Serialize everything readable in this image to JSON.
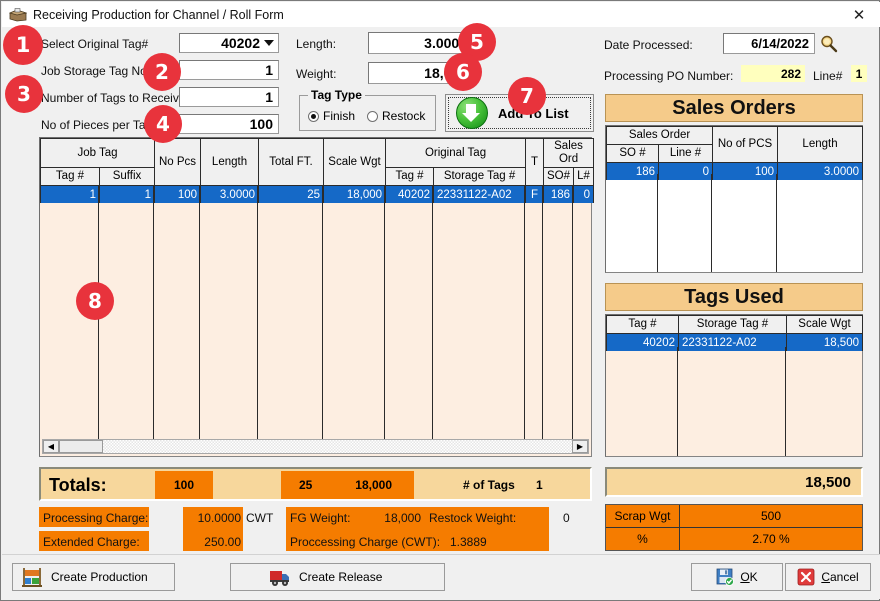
{
  "window": {
    "title": "Receiving Production for Channel / Roll Form",
    "close_label": "✕",
    "icon": "box-icon"
  },
  "form": {
    "select_original_tag_label": "Select Original Tag#",
    "select_original_tag_value": "40202",
    "job_storage_tag_label": "Job Storage Tag No:",
    "job_storage_tag_value": "1",
    "number_of_tags_label": "Number of Tags to Receive:",
    "number_of_tags_value": "1",
    "pieces_per_tag_label": "No of Pieces per Tag:",
    "pieces_per_tag_value": "100",
    "length_label": "Length:",
    "length_value": "3.0000",
    "weight_label": "Weight:",
    "weight_value": "18,000",
    "tag_type_title": "Tag Type",
    "tag_type_finish": "Finish",
    "tag_type_restock": "Restock",
    "tag_type_selected": "Finish",
    "add_to_list_label": "Add To List"
  },
  "header_right": {
    "date_processed_label": "Date Processed:",
    "date_processed_value": "6/14/2022",
    "date_picker_icon": "magnifier-icon",
    "po_number_label": "Processing PO Number:",
    "po_number_value": "282",
    "line_label": "Line#",
    "line_value": "1"
  },
  "main_grid": {
    "group_headers": {
      "job_tag": "Job Tag",
      "original_tag": "Original Tag",
      "sales_ord": "Sales Ord"
    },
    "columns": [
      "Tag #",
      "Suffix",
      "No Pcs",
      "Length",
      "Total FT.",
      "Scale Wgt",
      "Tag #",
      "Storage Tag #",
      "T",
      "SO#",
      "L#"
    ],
    "rows": [
      {
        "tag_no": "1",
        "suffix": "1",
        "no_pcs": "100",
        "length": "3.0000",
        "total_ft": "25",
        "scale_wgt": "18,000",
        "orig_tag_no": "40202",
        "orig_storage_tag": "22331122-A02",
        "t": "F",
        "so": "186",
        "l": "0"
      }
    ]
  },
  "sales_orders": {
    "panel_title": "Sales Orders",
    "group_header": "Sales Order",
    "columns": [
      "SO #",
      "Line #",
      "No of PCS",
      "Length"
    ],
    "rows": [
      {
        "so": "186",
        "line": "0",
        "no_of_pcs": "100",
        "length": "3.0000"
      }
    ]
  },
  "tags_used": {
    "panel_title": "Tags Used",
    "columns": [
      "Tag #",
      "Storage Tag #",
      "Scale Wgt"
    ],
    "rows": [
      {
        "tag": "40202",
        "storage_tag": "22331122-A02",
        "scale_wgt": "18,500"
      }
    ],
    "total": "18,500",
    "scrap_wgt_label": "Scrap Wgt",
    "scrap_wgt_value": "500",
    "percent_label": "%",
    "percent_value": "2.70 %"
  },
  "totals": {
    "label": "Totals:",
    "no_pcs": "100",
    "total_ft": "25",
    "scale_wgt": "18,000",
    "num_tags_label": "# of Tags",
    "num_tags_value": "1",
    "processing_charge_label": "Processing Charge:",
    "processing_charge_value": "10.0000",
    "processing_charge_unit": "CWT",
    "extended_charge_label": "Extended Charge:",
    "extended_charge_value": "250.00",
    "fg_weight_label": "FG Weight:",
    "fg_weight_value": "18,000",
    "restock_weight_label": "Restock Weight:",
    "restock_weight_value": "0",
    "processing_charge_cwt_label": "Proccessing Charge (CWT):",
    "processing_charge_cwt_value": "1.3889"
  },
  "toolbar": {
    "create_production": "Create Production",
    "create_release": "Create Release",
    "ok_accel": "O",
    "ok_rest": "K",
    "cancel_accel": "C",
    "cancel_rest": "ancel"
  },
  "badges": [
    {
      "n": "1"
    },
    {
      "n": "2"
    },
    {
      "n": "3"
    },
    {
      "n": "4"
    },
    {
      "n": "5"
    },
    {
      "n": "6"
    },
    {
      "n": "7"
    },
    {
      "n": "8"
    }
  ],
  "colors": {
    "selection_blue": "#1569c7",
    "panel_orange": "#f5cb8a",
    "data_orange": "#f57c00",
    "grid_bg": "#fdeee1",
    "badge_red": "#e8333c",
    "highlight_yellow": "#ffffbe"
  }
}
